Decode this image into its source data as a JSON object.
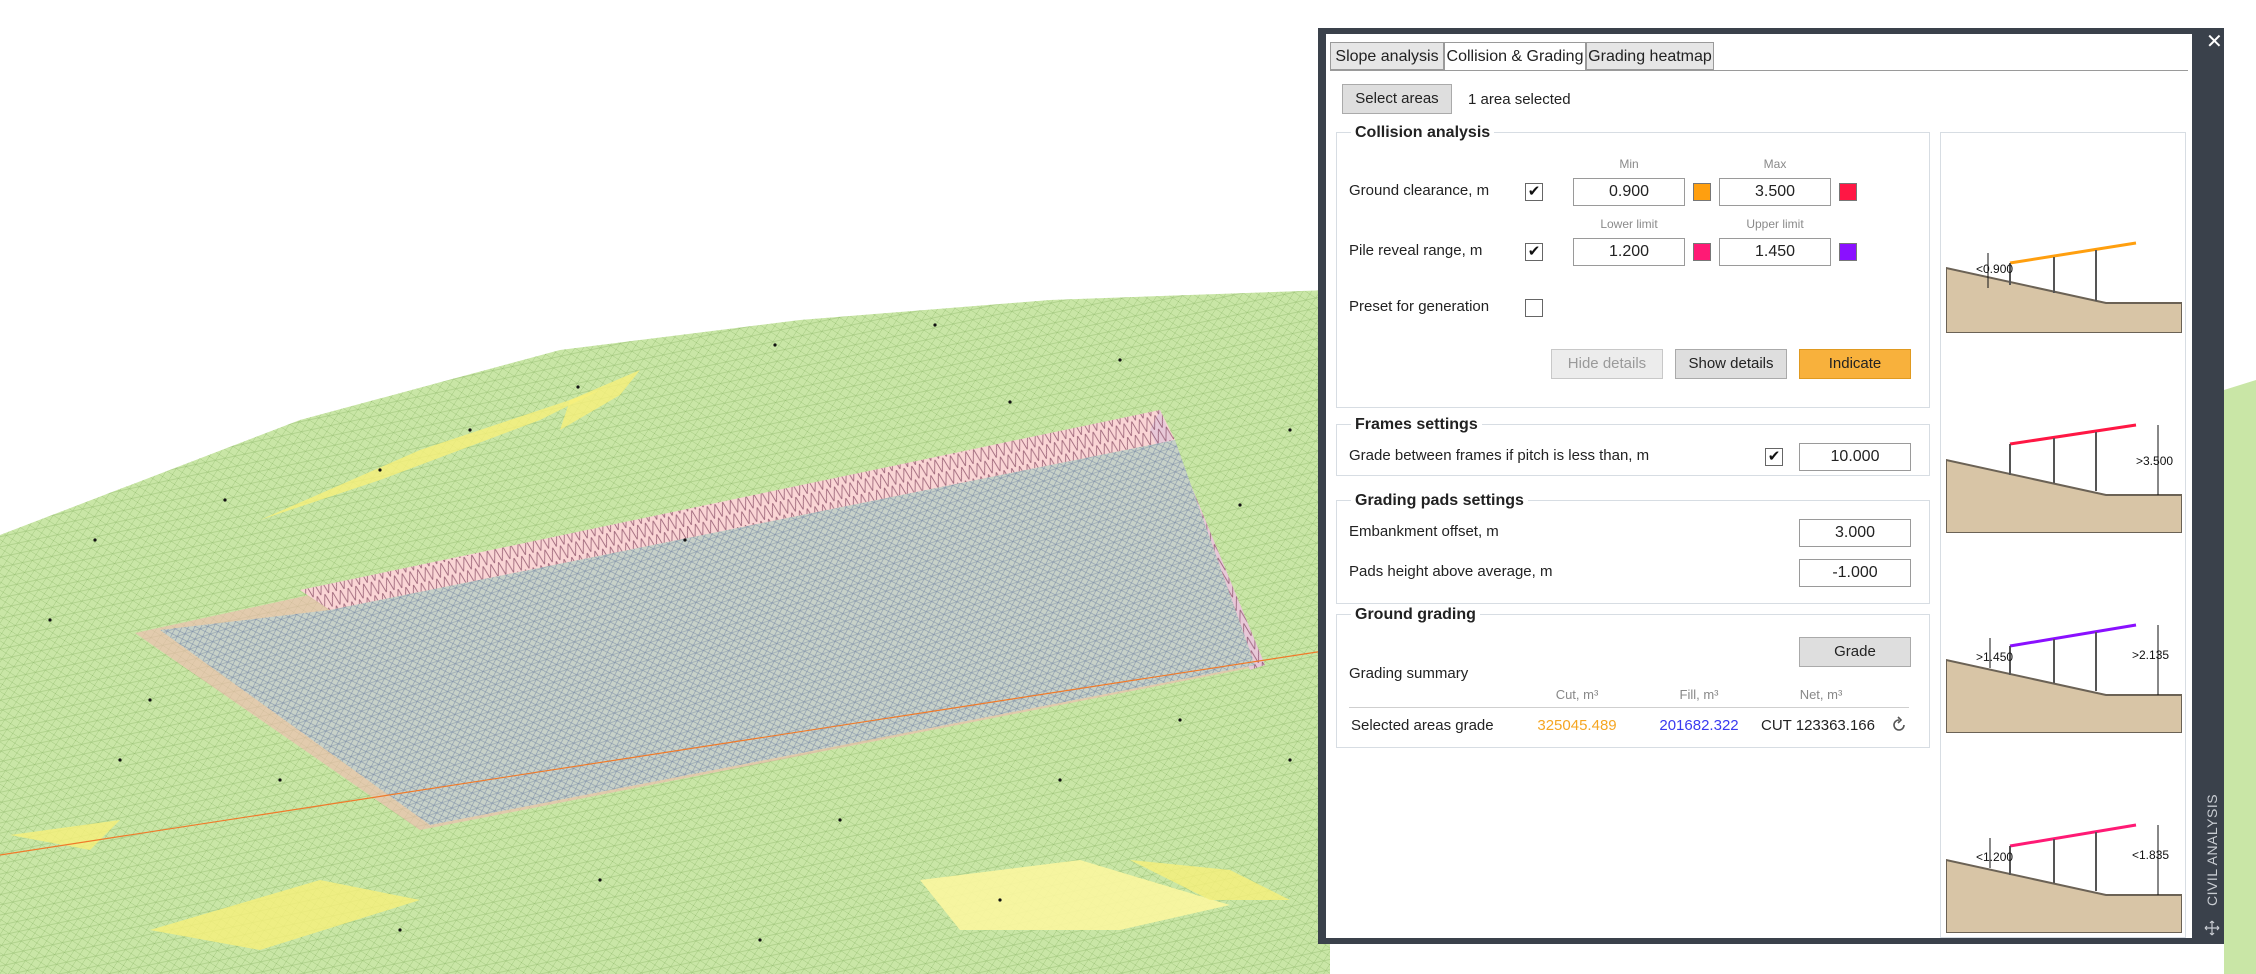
{
  "tabs": [
    {
      "label": "Slope analysis",
      "active": false
    },
    {
      "label": "Collision & Grading",
      "active": true
    },
    {
      "label": "Grading heatmap",
      "active": false
    }
  ],
  "select_areas": {
    "button": "Select areas",
    "status": "1 area selected"
  },
  "collision": {
    "title": "Collision analysis",
    "min_label": "Min",
    "max_label": "Max",
    "lower_limit_label": "Lower limit",
    "upper_limit_label": "Upper limit",
    "ground_clearance": {
      "label": "Ground clearance, m",
      "checked": true,
      "min": "0.900",
      "max": "3.500",
      "min_color": "#ff9f0f",
      "max_color": "#ff1744"
    },
    "pile_reveal": {
      "label": "Pile reveal range, m",
      "checked": true,
      "lower": "1.200",
      "upper": "1.450",
      "lower_color": "#ff1a75",
      "upper_color": "#8a10ff"
    },
    "preset": {
      "label": "Preset for generation",
      "checked": false
    },
    "hide_details": "Hide details",
    "show_details": "Show details",
    "indicate": "Indicate"
  },
  "frames": {
    "title": "Frames settings",
    "grade_label": "Grade between frames if pitch is less than, m",
    "checked": true,
    "value": "10.000"
  },
  "pads": {
    "title": "Grading pads settings",
    "embankment_label": "Embankment offset, m",
    "embankment_value": "3.000",
    "height_label": "Pads height above average, m",
    "height_value": "-1.000"
  },
  "grading": {
    "title": "Ground grading",
    "grade_button": "Grade",
    "summary_label": "Grading summary",
    "columns": [
      "Cut, m³",
      "Fill, m³",
      "Net, m³"
    ],
    "row": {
      "label": "Selected areas grade",
      "cut": "325045.489",
      "fill": "201682.322",
      "net": "CUT 123363.166"
    },
    "cut_color": "#f5a623",
    "fill_color": "#3a3af0"
  },
  "illustrations": [
    {
      "label": "<0.900",
      "beam_color": "#ff9f0f"
    },
    {
      "label": ">3.500",
      "beam_color": "#ff1744"
    },
    {
      "label_left": ">1.450",
      "label_right": ">2.135",
      "beam_color": "#8a10ff"
    },
    {
      "label_left": "<1.200",
      "label_right": "<1.835",
      "beam_color": "#ff1a75"
    }
  ],
  "side_label": "CIVIL ANALYSIS",
  "close_icon": "close-icon"
}
